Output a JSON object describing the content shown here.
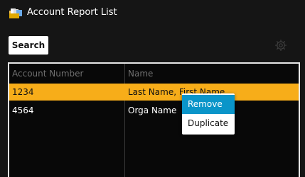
{
  "window": {
    "title": "Account Report List",
    "icon": "folder-docs-icon"
  },
  "toolbar": {
    "search_label": "Search",
    "settings_icon": "gear-icon"
  },
  "table": {
    "columns": [
      "Account Number",
      "Name"
    ],
    "rows": [
      {
        "account_number": "1234",
        "name": "Last Name, First Name",
        "selected": true
      },
      {
        "account_number": "4564",
        "name": "Orga Name",
        "selected": false
      }
    ],
    "selected_color": "#f7ad19"
  },
  "context_menu": {
    "items": [
      "Remove",
      "Duplicate"
    ],
    "highlighted": "Remove",
    "highlight_color": "#0a95c9"
  }
}
